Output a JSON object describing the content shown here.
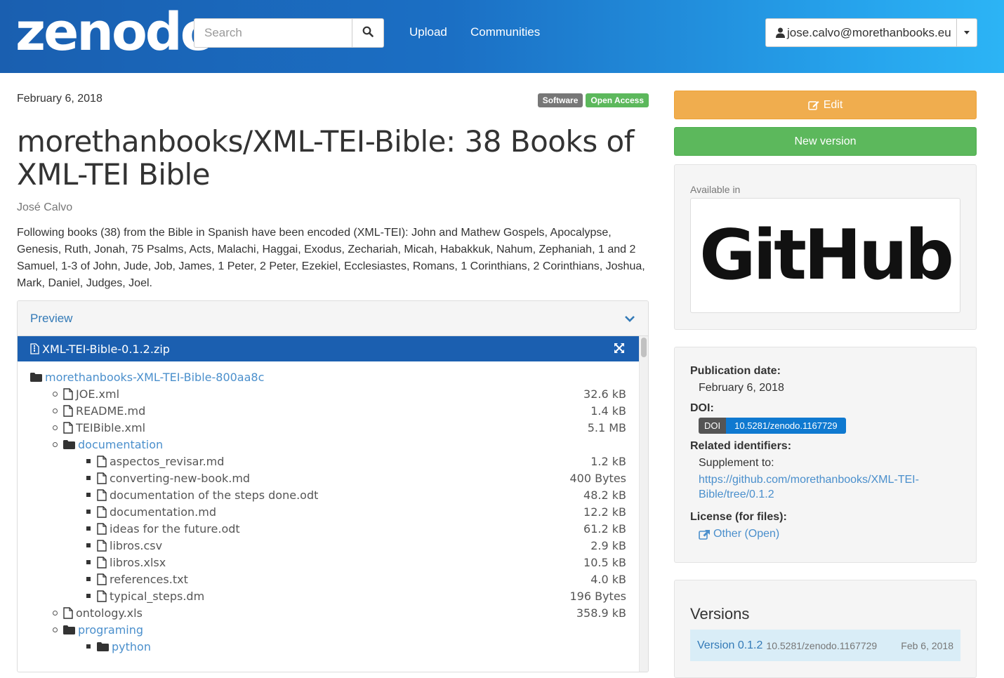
{
  "header": {
    "logo": "zenodo",
    "search_placeholder": "Search",
    "nav": [
      "Upload",
      "Communities"
    ],
    "user_email": "jose.calvo@morethanbooks.eu"
  },
  "record": {
    "date": "February 6, 2018",
    "badges": [
      "Software",
      "Open Access"
    ],
    "title": "morethanbooks/XML-TEI-Bible: 38 Books of XML-TEI Bible",
    "author": "José Calvo",
    "description": "Following books (38) from the Bible in Spanish have been encoded (XML-TEI): John and Mathew Gospels, Apocalypse, Genesis, Ruth, Jonah, 75 Psalms, Acts, Malachi, Haggai, Exodus, Zechariah, Micah, Habakkuk, Nahum, Zephaniah, 1 and 2 Samuel, 1-3 of John, Jude, Job, James, 1 Peter, 2 Peter, Ezekiel, Ecclesiastes, Romans, 1 Corinthians, 2 Corinthians, Joshua, Mark, Daniel, Judges, Joel."
  },
  "preview": {
    "heading": "Preview",
    "archive": "XML-TEI-Bible-0.1.2.zip",
    "tree": [
      {
        "level": 0,
        "type": "folder",
        "name": "morethanbooks-XML-TEI-Bible-800aa8c",
        "size": ""
      },
      {
        "level": 1,
        "type": "file",
        "name": "JOE.xml",
        "size": "32.6 kB"
      },
      {
        "level": 1,
        "type": "file",
        "name": "README.md",
        "size": "1.4 kB"
      },
      {
        "level": 1,
        "type": "file",
        "name": "TEIBible.xml",
        "size": "5.1 MB"
      },
      {
        "level": 1,
        "type": "folder",
        "name": "documentation",
        "size": ""
      },
      {
        "level": 2,
        "type": "file",
        "name": "aspectos_revisar.md",
        "size": "1.2 kB"
      },
      {
        "level": 2,
        "type": "file",
        "name": "converting-new-book.md",
        "size": "400 Bytes"
      },
      {
        "level": 2,
        "type": "file",
        "name": "documentation of the steps done.odt",
        "size": "48.2 kB"
      },
      {
        "level": 2,
        "type": "file",
        "name": "documentation.md",
        "size": "12.2 kB"
      },
      {
        "level": 2,
        "type": "file",
        "name": "ideas for the future.odt",
        "size": "61.2 kB"
      },
      {
        "level": 2,
        "type": "file",
        "name": "libros.csv",
        "size": "2.9 kB"
      },
      {
        "level": 2,
        "type": "file",
        "name": "libros.xlsx",
        "size": "10.5 kB"
      },
      {
        "level": 2,
        "type": "file",
        "name": "references.txt",
        "size": "4.0 kB"
      },
      {
        "level": 2,
        "type": "file",
        "name": "typical_steps.dm",
        "size": "196 Bytes"
      },
      {
        "level": 1,
        "type": "file",
        "name": "ontology.xls",
        "size": "358.9 kB"
      },
      {
        "level": 1,
        "type": "folder",
        "name": "programing",
        "size": ""
      },
      {
        "level": 2,
        "type": "folder",
        "name": "python",
        "size": ""
      }
    ]
  },
  "sidebar": {
    "edit_label": "Edit",
    "new_version_label": "New version",
    "available_in": "Available in",
    "github_logo_text": "GitHub",
    "publication_date_label": "Publication date:",
    "publication_date": "February 6, 2018",
    "doi_label": "DOI:",
    "doi_prefix": "DOI",
    "doi_value": "10.5281/zenodo.1167729",
    "related_label": "Related identifiers:",
    "supplement_label": "Supplement to:",
    "supplement_link_line1": "https://github.com/morethanbooks/XML-TEI-",
    "supplement_link_line2": "Bible/tree/0.1.2",
    "license_label": "License (for files):",
    "license_value": "Other (Open)",
    "versions_title": "Versions",
    "version_name": "Version 0.1.2",
    "version_doi": "10.5281/zenodo.1167729",
    "version_date": "Feb 6, 2018"
  },
  "colors": {
    "header_start": "#1a5fb0",
    "header_end": "#2cb4f5",
    "edit": "#f0ad4e",
    "new_version": "#5cb85c",
    "file_bar": "#1b5fb0",
    "doi": "#0f79d0"
  }
}
